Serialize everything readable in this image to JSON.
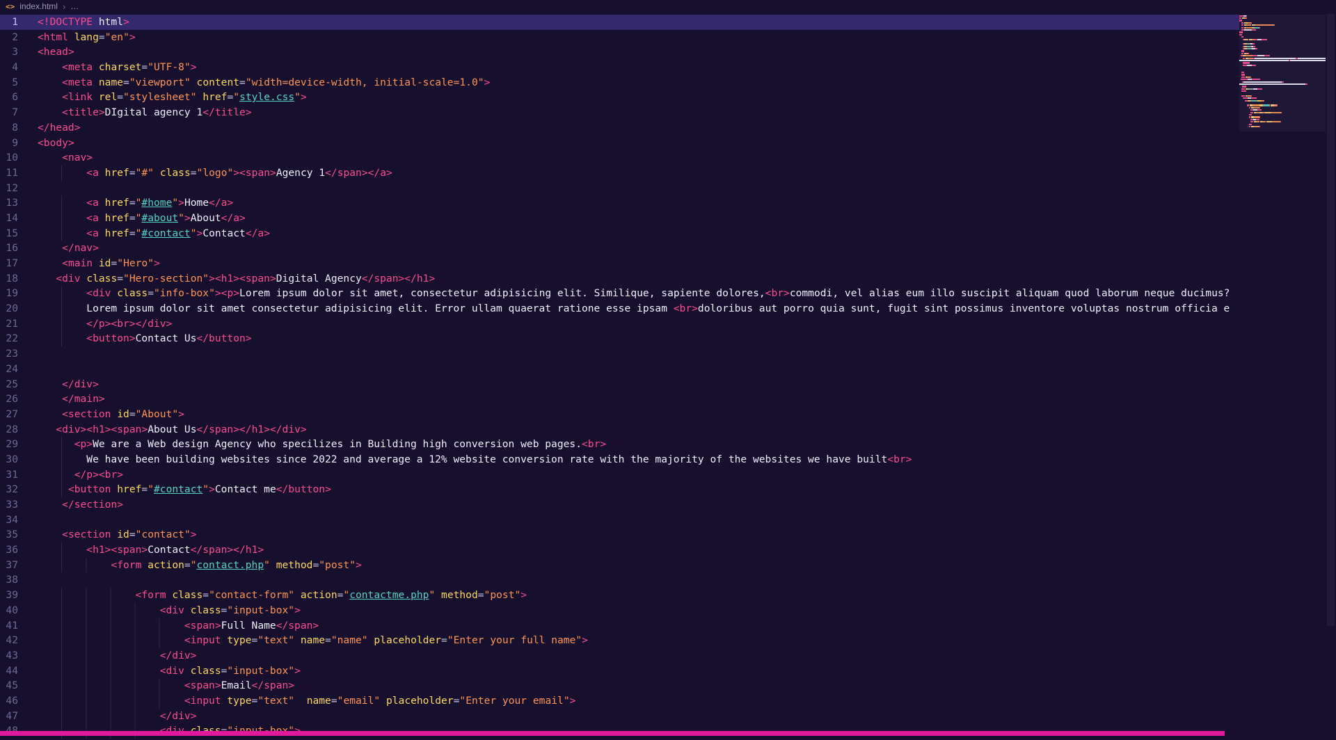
{
  "breadcrumb": {
    "file_icon_glyph": "<>",
    "file_name": "index.html",
    "separator": "›",
    "ellipsis": "…"
  },
  "editor": {
    "active_line": 1,
    "lines": [
      "<!DOCTYPE html>",
      "<html lang=\"en\">",
      "<head>",
      "    <meta charset=\"UTF-8\">",
      "    <meta name=\"viewport\" content=\"width=device-width, initial-scale=1.0\">",
      "    <link rel=\"stylesheet\" href=\"style.css\">",
      "    <title>DIgital agency 1</title>",
      "</head>",
      "<body>",
      "    <nav>",
      "        <a href=\"#\" class=\"logo\"><span>Agency 1</span></a>",
      "",
      "        <a href=\"#home\">Home</a>",
      "        <a href=\"#about\">About</a>",
      "        <a href=\"#contact\">Contact</a>",
      "    </nav>",
      "    <main id=\"Hero\">",
      "   <div class=\"Hero-section\"><h1><span>Digital Agency</span></h1>",
      "        <div class=\"info-box\"><p>Lorem ipsum dolor sit amet, consectetur adipisicing elit. Similique, sapiente dolores,<br>commodi, vel alias eum illo suscipit aliquam quod laborum neque ducimus?",
      "        Lorem ipsum dolor sit amet consectetur adipisicing elit. Error ullam quaerat ratione esse ipsam <br>doloribus aut porro quia sunt, fugit sint possimus inventore voluptas nostrum officia e",
      "        </p><br></div>",
      "        <button>Contact Us</button>",
      "",
      "",
      "    </div>",
      "    </main>",
      "    <section id=\"About\">",
      "   <div><h1><span>About Us</span></h1></div>",
      "      <p>We are a Web design Agency who specilizes in Building high conversion web pages.<br>",
      "        We have been building websites since 2022 and average a 12% website conversion rate with the majority of the websites we have built<br>",
      "      </p><br>",
      "     <button href=\"#contact\">Contact me</button>",
      "    </section>",
      "",
      "    <section id=\"contact\">",
      "        <h1><span>Contact</span></h1>",
      "            <form action=\"contact.php\" method=\"post\">",
      "",
      "                <form class=\"contact-form\" action=\"contactme.php\" method=\"post\">",
      "                    <div class=\"input-box\">",
      "                        <span>Full Name</span>",
      "                        <input type=\"text\" name=\"name\" placeholder=\"Enter your full name\">",
      "                    </div>",
      "                    <div class=\"input-box\">",
      "                        <span>Email</span>",
      "                        <input type=\"text\"  name=\"email\" placeholder=\"Enter your email\">",
      "                    </div>",
      "                    <div class=\"input-box\">"
    ]
  },
  "colors": {
    "bg": "#160f2e",
    "lineHl": "#35296d",
    "gutter": "#6f6a94",
    "gutterActive": "#c9c3ec",
    "tag": "#fb4b8e",
    "attr": "#ffd75e",
    "string": "#ff9352",
    "link": "#53d3c2",
    "text": "#f2efff",
    "punct": "#cfc9ea",
    "guide": "#2c2550",
    "bcFg": "#9d97bb",
    "bcSep": "#6e6890",
    "fileIcon": "#e8a33d",
    "hbar": "#e2199d"
  }
}
